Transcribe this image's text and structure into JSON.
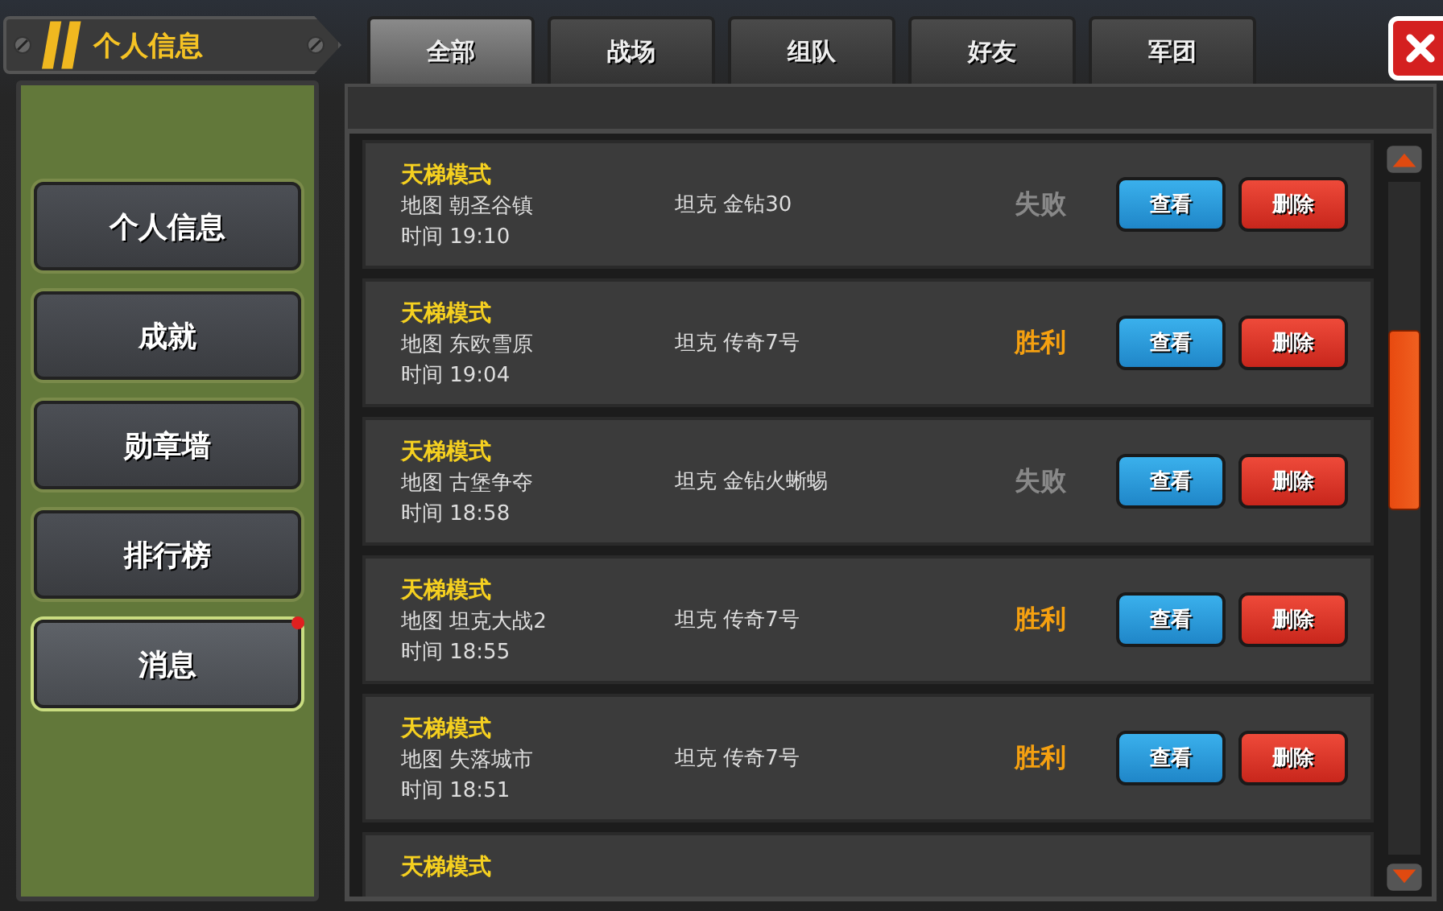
{
  "header": {
    "title": "个人信息"
  },
  "sidebar": {
    "items": [
      {
        "label": "个人信息",
        "selected": false,
        "badge": false
      },
      {
        "label": "成就",
        "selected": false,
        "badge": false
      },
      {
        "label": "勋章墙",
        "selected": false,
        "badge": false
      },
      {
        "label": "排行榜",
        "selected": false,
        "badge": false
      },
      {
        "label": "消息",
        "selected": true,
        "badge": true
      }
    ]
  },
  "tabs": [
    {
      "label": "全部",
      "selected": true
    },
    {
      "label": "战场",
      "selected": false
    },
    {
      "label": "组队",
      "selected": false
    },
    {
      "label": "好友",
      "selected": false
    },
    {
      "label": "军团",
      "selected": false
    }
  ],
  "records": [
    {
      "title": "天梯模式",
      "map": "地图 朝圣谷镇",
      "time": "时间 19:10",
      "tank": "坦克 金钻30",
      "result": "失败",
      "win": false,
      "view": "查看",
      "delete": "删除"
    },
    {
      "title": "天梯模式",
      "map": "地图 东欧雪原",
      "time": "时间 19:04",
      "tank": "坦克 传奇7号",
      "result": "胜利",
      "win": true,
      "view": "查看",
      "delete": "删除"
    },
    {
      "title": "天梯模式",
      "map": "地图 古堡争夺",
      "time": "时间 18:58",
      "tank": "坦克 金钻火蜥蜴",
      "result": "失败",
      "win": false,
      "view": "查看",
      "delete": "删除"
    },
    {
      "title": "天梯模式",
      "map": "地图 坦克大战2",
      "time": "时间 18:55",
      "tank": "坦克 传奇7号",
      "result": "胜利",
      "win": true,
      "view": "查看",
      "delete": "删除"
    },
    {
      "title": "天梯模式",
      "map": "地图 失落城市",
      "time": "时间 18:51",
      "tank": "坦克 传奇7号",
      "result": "胜利",
      "win": true,
      "view": "查看",
      "delete": "删除"
    },
    {
      "title": "天梯模式"
    }
  ]
}
